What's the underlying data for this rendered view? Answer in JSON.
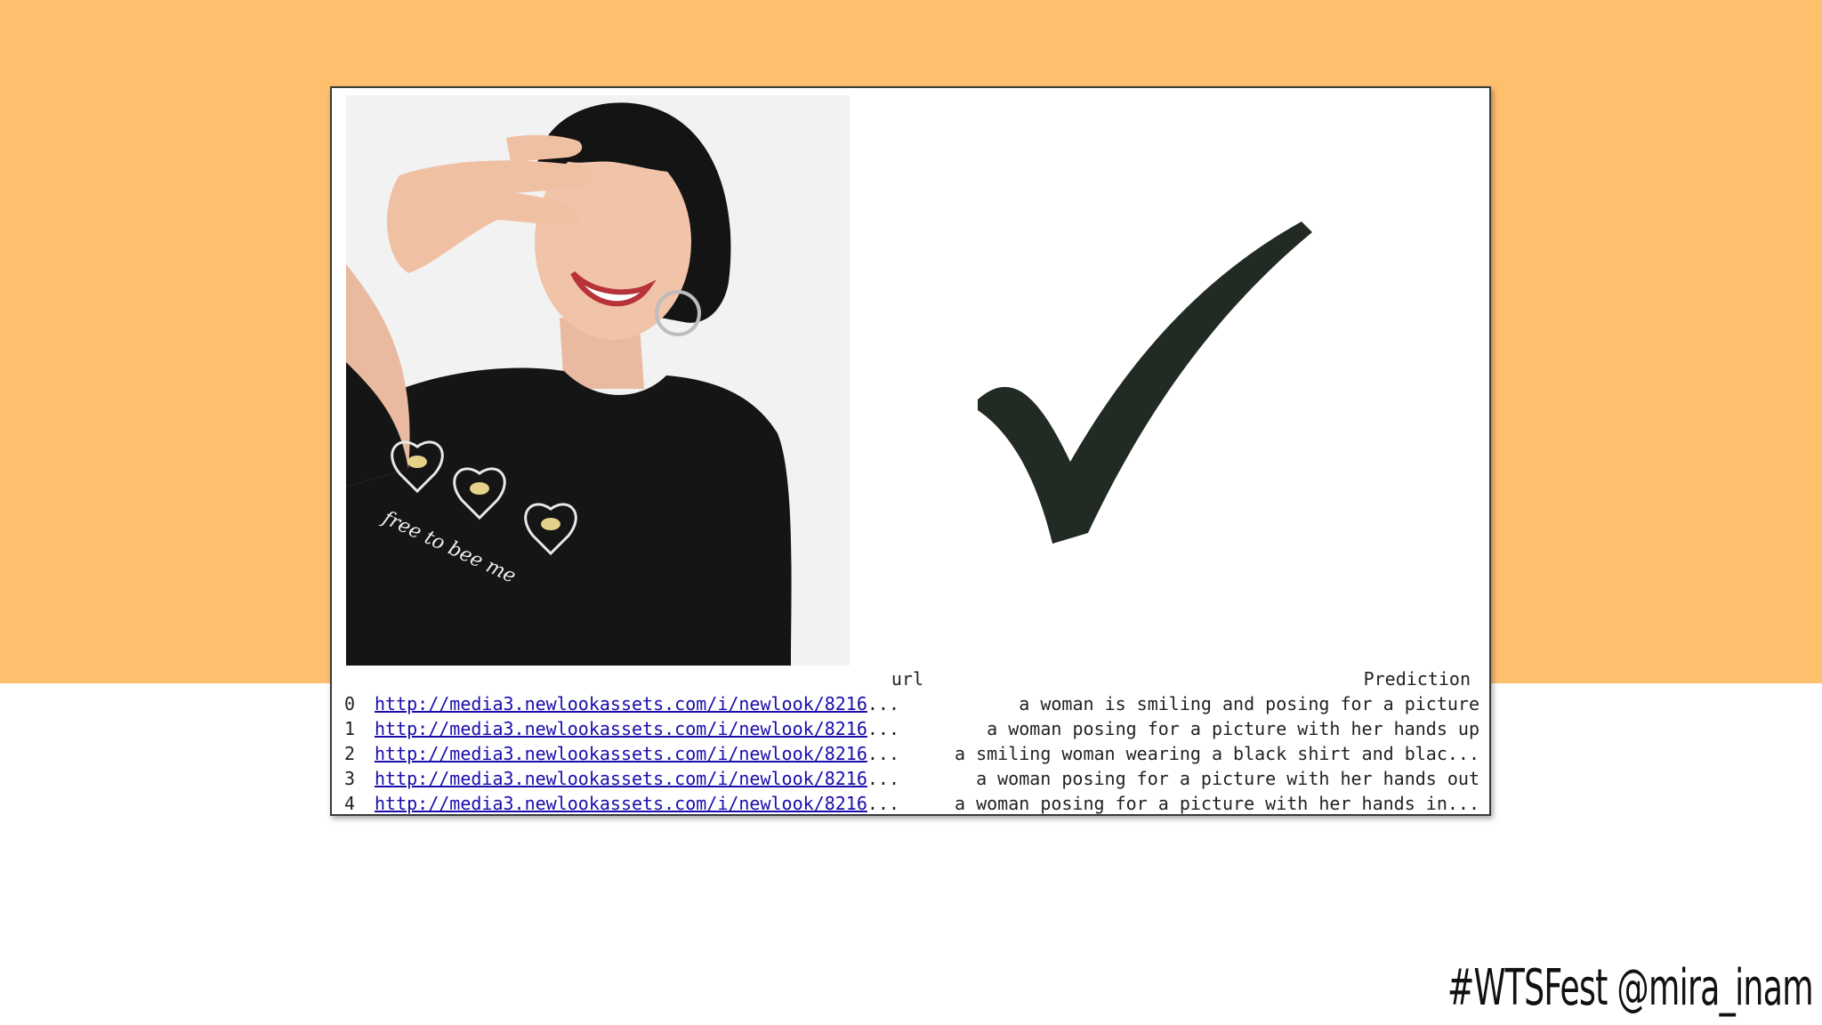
{
  "colors": {
    "top_band": "#FFC06E",
    "link": "#1a0dab",
    "check": "#222a24"
  },
  "photo": {
    "shirt_text": "free to bee me"
  },
  "check_icon": "checkmark-icon",
  "table": {
    "headers": {
      "url": "url",
      "prediction": "Prediction"
    },
    "rows": [
      {
        "index": "0",
        "url": "http://media3.newlookassets.com/i/newlook/8216",
        "ellipsis": "...",
        "prediction": "a woman is smiling and posing for a picture"
      },
      {
        "index": "1",
        "url": "http://media3.newlookassets.com/i/newlook/8216",
        "ellipsis": "...",
        "prediction": "a woman posing for a picture with her hands up"
      },
      {
        "index": "2",
        "url": "http://media3.newlookassets.com/i/newlook/8216",
        "ellipsis": "...",
        "prediction": "a smiling woman wearing a black shirt and blac..."
      },
      {
        "index": "3",
        "url": "http://media3.newlookassets.com/i/newlook/8216",
        "ellipsis": "...",
        "prediction": "a woman posing for a picture with her hands out"
      },
      {
        "index": "4",
        "url": "http://media3.newlookassets.com/i/newlook/8216",
        "ellipsis": "...",
        "prediction": "a woman posing for a picture with her hands in..."
      }
    ]
  },
  "footer": {
    "hashtag": "#WTSFest @mira_inam"
  }
}
